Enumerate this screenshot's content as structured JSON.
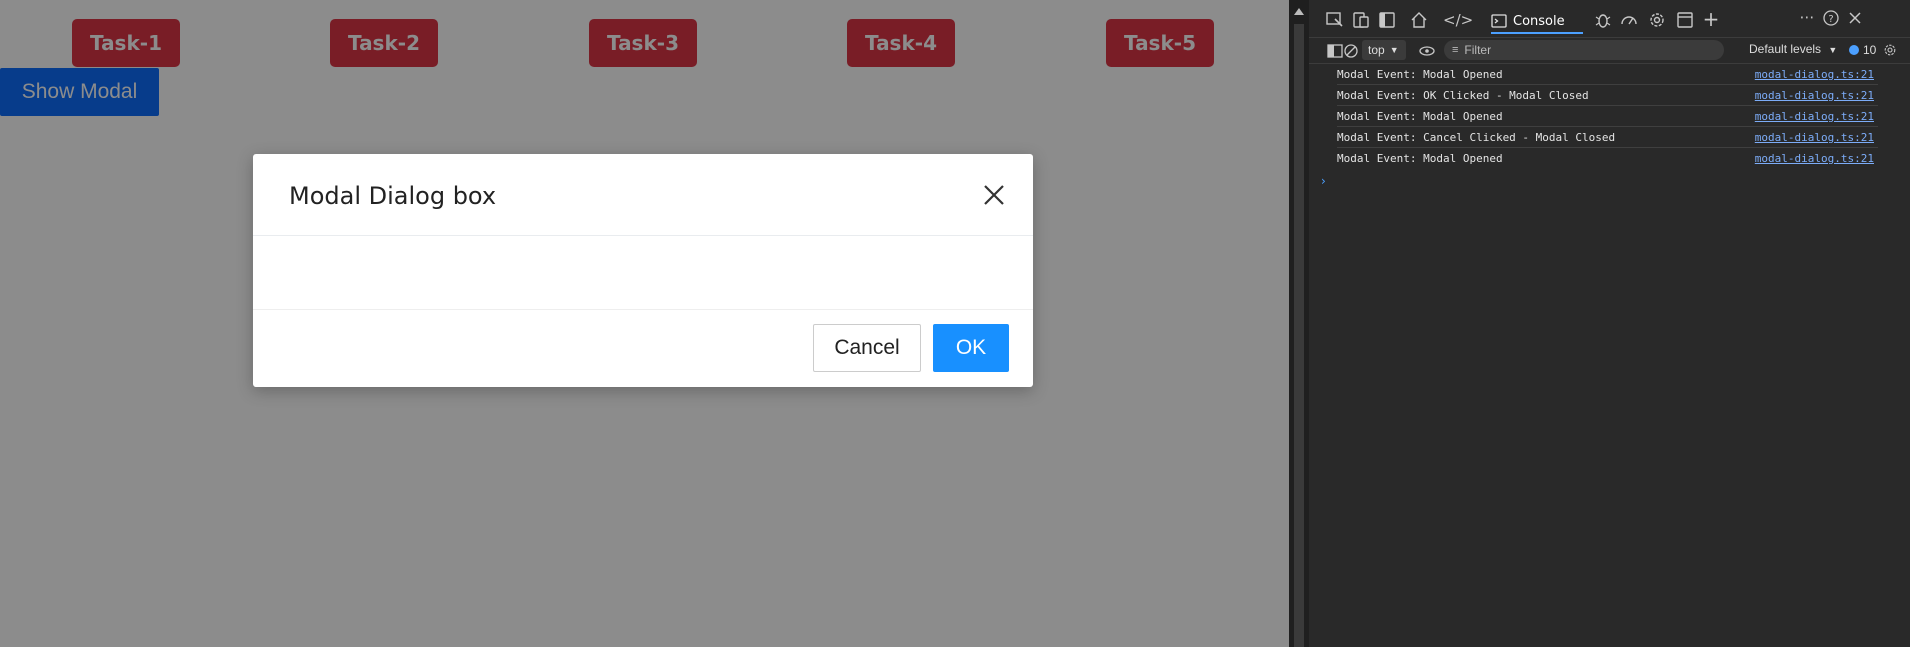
{
  "app": {
    "tasks": [
      "Task-1",
      "Task-2",
      "Task-3",
      "Task-4",
      "Task-5"
    ],
    "show_modal_label": "Show Modal",
    "colors": {
      "task": "#dc3545",
      "primary": "#0d6efd",
      "ok": "#1890ff"
    }
  },
  "modal": {
    "title": "Modal Dialog box",
    "cancel_label": "Cancel",
    "ok_label": "OK",
    "close_icon": "close-icon"
  },
  "devtools": {
    "active_tab": "Console",
    "context": "top",
    "filter_placeholder": "Filter",
    "levels": "Default levels",
    "issues_count": "10",
    "logs": [
      {
        "msg": "Modal Event: Modal Opened",
        "src": "modal-dialog.ts:21"
      },
      {
        "msg": "Modal Event: OK Clicked - Modal Closed",
        "src": "modal-dialog.ts:21"
      },
      {
        "msg": "Modal Event: Modal Opened",
        "src": "modal-dialog.ts:21"
      },
      {
        "msg": "Modal Event: Cancel Clicked - Modal Closed",
        "src": "modal-dialog.ts:21"
      },
      {
        "msg": "Modal Event: Modal Opened",
        "src": "modal-dialog.ts:21"
      }
    ],
    "prompt": "›"
  }
}
